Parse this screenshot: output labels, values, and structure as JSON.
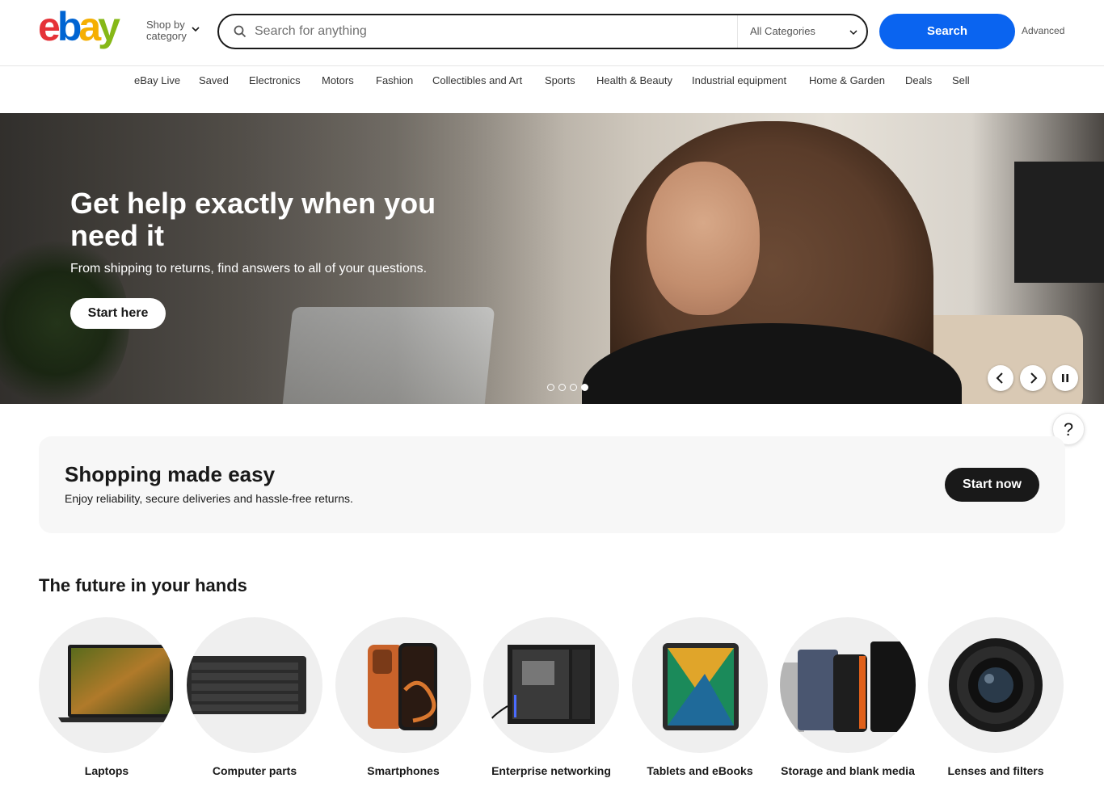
{
  "header": {
    "logo_letters": [
      "e",
      "b",
      "a",
      "y"
    ],
    "shop_by_category": "Shop by category",
    "search_placeholder": "Search for anything",
    "category_select": "All Categories",
    "search_button": "Search",
    "advanced_link": "Advanced"
  },
  "nav": {
    "items": [
      "eBay Live",
      "Saved",
      "Electronics",
      "Motors",
      "Fashion",
      "Collectibles and Art",
      "Sports",
      "Health & Beauty",
      "Industrial equipment",
      "Home & Garden",
      "Deals",
      "Sell"
    ]
  },
  "hero": {
    "title": "Get help exactly when you need it",
    "subtitle": "From shipping to returns, find answers to all of your questions.",
    "cta": "Start here",
    "slide_count": 4,
    "active_slide": 4
  },
  "help_button": "?",
  "promo": {
    "title": "Shopping made easy",
    "subtitle": "Enjoy reliability, secure deliveries and hassle-free returns.",
    "cta": "Start now"
  },
  "future": {
    "title": "The future in your hands",
    "categories": [
      "Laptops",
      "Computer parts",
      "Smartphones",
      "Enterprise networking",
      "Tablets and eBooks",
      "Storage and blank media",
      "Lenses and filters"
    ]
  },
  "colors": {
    "search_button": "#0a64f0",
    "logo_e": "#e53238",
    "logo_b": "#0064d2",
    "logo_a": "#f5af02",
    "logo_y": "#86b817"
  },
  "icons": {
    "search": "search-icon",
    "chevron": "chevron-down-icon",
    "prev": "chevron-left-icon",
    "next": "chevron-right-icon",
    "pause": "pause-icon"
  }
}
